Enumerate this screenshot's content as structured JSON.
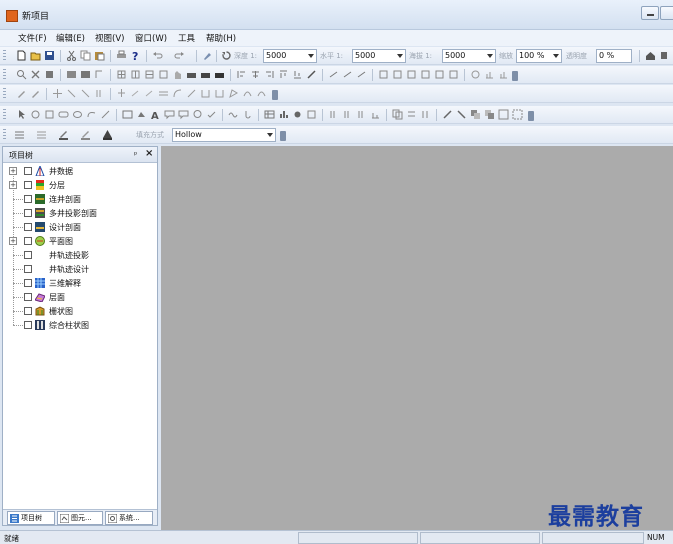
{
  "window": {
    "title": "新项目"
  },
  "menu": [
    "文件(F)",
    "编辑(E)",
    "视图(V)",
    "窗口(W)",
    "工具",
    "帮助(H)"
  ],
  "toolbar_params": {
    "depth_label": "深度 1:",
    "depth_value": "5000",
    "horizontal_label": "水平 1:",
    "horizontal_value": "5000",
    "sea_label": "海拔 1:",
    "sea_value": "5000",
    "zoom_label": "缩放",
    "zoom_value": "100 %",
    "opacity_label": "透明度",
    "opacity_value": "0 %"
  },
  "toolbar_fill": {
    "fill_label": "填充方式",
    "fill_value": "Hollow"
  },
  "project_tree": {
    "title": "项目树",
    "items": [
      {
        "label": "井数据",
        "expander": "+"
      },
      {
        "label": "分层",
        "expander": "+"
      },
      {
        "label": "连井剖面",
        "expander": ""
      },
      {
        "label": "多井投影剖面",
        "expander": ""
      },
      {
        "label": "设计剖面",
        "expander": ""
      },
      {
        "label": "平面图",
        "expander": "+"
      },
      {
        "label": "井轨迹投影",
        "expander": ""
      },
      {
        "label": "井轨迹设计",
        "expander": ""
      },
      {
        "label": "三维解释",
        "expander": ""
      },
      {
        "label": "层面",
        "expander": ""
      },
      {
        "label": "栅状图",
        "expander": ""
      },
      {
        "label": "综合柱状图",
        "expander": ""
      }
    ]
  },
  "pane_tabs": [
    "项目树",
    "图元...",
    "系统..."
  ],
  "status": {
    "text": "就绪",
    "num": "NUM"
  },
  "watermark": "最需教育",
  "colors": {
    "workspace": "#ababab",
    "watermark": "#1c3f9e",
    "app_icon": "#e0651d"
  }
}
